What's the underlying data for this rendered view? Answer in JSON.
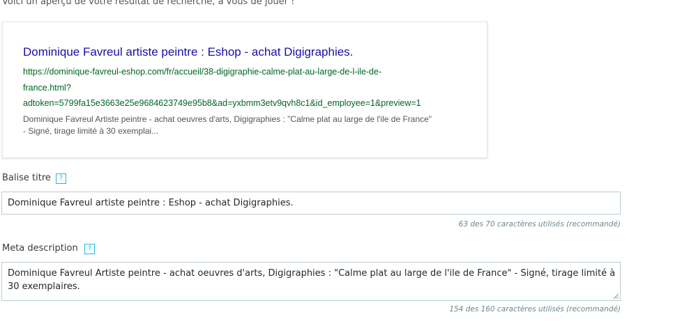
{
  "intro_text": "Voici un aperçu de votre résultat de recherche, à vous de jouer !",
  "preview": {
    "title": "Dominique Favreul artiste peintre : Eshop - achat Digigraphies.",
    "url_lines": [
      "https://dominique-favreul-eshop.com/fr/accueil/38-digigraphie-calme-plat-au-large-de-l-ile-de-",
      "france.html?",
      "adtoken=5799fa15e3663e25e9684623749e95b8&ad=yxbmm3etv9qvh8c1&id_employee=1&preview=1"
    ],
    "description_lines": [
      "Dominique Favreul Artiste peintre - achat oeuvres d'arts, Digigraphies : \"Calme plat au large de l'ile de France\"",
      "- Signé, tirage limité à 30 exemplai..."
    ]
  },
  "title_field": {
    "label": "Balise titre",
    "help_icon": "?",
    "value": "Dominique Favreul artiste peintre : Eshop - achat Digigraphies.",
    "counter": "63 des 70 caractères utilisés (recommandé)"
  },
  "description_field": {
    "label": "Meta description",
    "help_icon": "?",
    "value_lines": [
      "Dominique Favreul Artiste peintre - achat oeuvres d'arts, Digigraphies : \"Calme plat au large de l'ile de France\" - Signé, tirage limité à",
      "30 exemplaires."
    ],
    "counter": "154 des 160 caractères utilisés (recommandé)"
  },
  "colors": {
    "serp_title": "#1a0dab",
    "serp_url": "#006621",
    "help_icon": "#25b9d7",
    "input_border": "#bbcdd2"
  }
}
